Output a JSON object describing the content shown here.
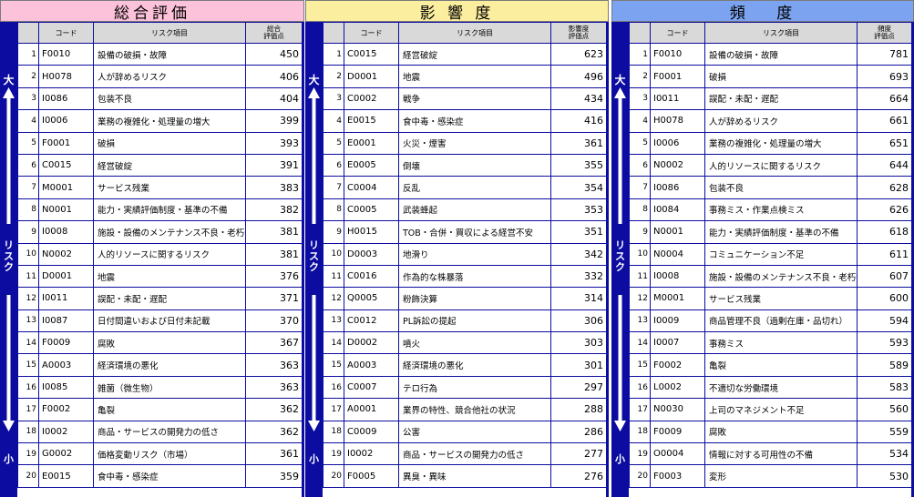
{
  "headers": {
    "code": "コード",
    "item": "リスク項目"
  },
  "side": {
    "big": "大",
    "small": "小",
    "mid": "リ\nス\nク"
  },
  "panels": [
    {
      "title": "総合評価",
      "title_bg": "#fcc2d9",
      "score_header": "総合\n評価点",
      "rows": [
        [
          "1",
          "F0010",
          "設備の破損・故障",
          "450"
        ],
        [
          "2",
          "H0078",
          "人が辞めるリスク",
          "406"
        ],
        [
          "3",
          "I0086",
          "包装不良",
          "404"
        ],
        [
          "4",
          "I0006",
          "業務の複雑化・処理量の増大",
          "399"
        ],
        [
          "5",
          "F0001",
          "破損",
          "393"
        ],
        [
          "6",
          "C0015",
          "経営破綻",
          "391"
        ],
        [
          "7",
          "M0001",
          "サービス残業",
          "383"
        ],
        [
          "8",
          "N0001",
          "能力・実績評価制度・基準の不備",
          "382"
        ],
        [
          "9",
          "I0008",
          "施設・設備のメンテナンス不良・老朽化",
          "381"
        ],
        [
          "10",
          "N0002",
          "人的リソースに関するリスク",
          "381"
        ],
        [
          "11",
          "D0001",
          "地震",
          "376"
        ],
        [
          "12",
          "I0011",
          "誤配・未配・遅配",
          "371"
        ],
        [
          "13",
          "I0087",
          "日付間違いおよび日付未記載",
          "370"
        ],
        [
          "14",
          "F0009",
          "腐敗",
          "367"
        ],
        [
          "15",
          "A0003",
          "経済環境の悪化",
          "363"
        ],
        [
          "16",
          "I0085",
          "雑菌（微生物）",
          "363"
        ],
        [
          "17",
          "F0002",
          "亀裂",
          "362"
        ],
        [
          "18",
          "I0002",
          "商品・サービスの開発力の低さ",
          "362"
        ],
        [
          "19",
          "G0002",
          "価格変動リスク（市場）",
          "361"
        ],
        [
          "20",
          "E0015",
          "食中毒・感染症",
          "359"
        ]
      ]
    },
    {
      "title": "影 響 度",
      "title_bg": "#fbee9e",
      "score_header": "影響度\n評価点",
      "rows": [
        [
          "1",
          "C0015",
          "経営破綻",
          "623"
        ],
        [
          "2",
          "D0001",
          "地震",
          "496"
        ],
        [
          "3",
          "C0002",
          "戦争",
          "434"
        ],
        [
          "4",
          "E0015",
          "食中毒・感染症",
          "416"
        ],
        [
          "5",
          "E0001",
          "火災・煙害",
          "361"
        ],
        [
          "6",
          "E0005",
          "倒壊",
          "355"
        ],
        [
          "7",
          "C0004",
          "反乱",
          "354"
        ],
        [
          "8",
          "C0005",
          "武装蜂起",
          "353"
        ],
        [
          "9",
          "H0015",
          "TOB・合併・買収による経営不安",
          "351"
        ],
        [
          "10",
          "D0003",
          "地滑り",
          "342"
        ],
        [
          "11",
          "C0016",
          "作為的な株暴落",
          "332"
        ],
        [
          "12",
          "Q0005",
          "粉飾決算",
          "314"
        ],
        [
          "13",
          "C0012",
          "PL訴訟の提起",
          "306"
        ],
        [
          "14",
          "D0002",
          "噴火",
          "303"
        ],
        [
          "15",
          "A0003",
          "経済環境の悪化",
          "301"
        ],
        [
          "16",
          "C0007",
          "テロ行為",
          "297"
        ],
        [
          "17",
          "A0001",
          "業界の特性、競合他社の状況",
          "288"
        ],
        [
          "18",
          "C0009",
          "公害",
          "286"
        ],
        [
          "19",
          "I0002",
          "商品・サービスの開発力の低さ",
          "277"
        ],
        [
          "20",
          "F0005",
          "異臭・異味",
          "276"
        ]
      ]
    },
    {
      "title": "頻 　度",
      "title_bg": "#7ca3ef",
      "score_header": "頻度\n評価点",
      "rows": [
        [
          "1",
          "F0010",
          "設備の破損・故障",
          "781"
        ],
        [
          "2",
          "F0001",
          "破損",
          "693"
        ],
        [
          "3",
          "I0011",
          "誤配・未配・遅配",
          "664"
        ],
        [
          "4",
          "H0078",
          "人が辞めるリスク",
          "661"
        ],
        [
          "5",
          "I0006",
          "業務の複雑化・処理量の増大",
          "651"
        ],
        [
          "6",
          "N0002",
          "人的リソースに関するリスク",
          "644"
        ],
        [
          "7",
          "I0086",
          "包装不良",
          "628"
        ],
        [
          "8",
          "I0084",
          "事務ミス・作業点検ミス",
          "626"
        ],
        [
          "9",
          "N0001",
          "能力・実績評価制度・基準の不備",
          "618"
        ],
        [
          "10",
          "N0004",
          "コミュニケーション不足",
          "611"
        ],
        [
          "11",
          "I0008",
          "施設・設備のメンテナンス不良・老朽化",
          "607"
        ],
        [
          "12",
          "M0001",
          "サービス残業",
          "600"
        ],
        [
          "13",
          "I0009",
          "商品管理不良（過剰在庫・品切れ）",
          "594"
        ],
        [
          "14",
          "I0007",
          "事務ミス",
          "593"
        ],
        [
          "15",
          "F0002",
          "亀裂",
          "589"
        ],
        [
          "16",
          "L0002",
          "不適切な労働環境",
          "583"
        ],
        [
          "17",
          "N0030",
          "上司のマネジメント不足",
          "560"
        ],
        [
          "18",
          "F0009",
          "腐敗",
          "559"
        ],
        [
          "19",
          "O0004",
          "情報に対する可用性の不備",
          "534"
        ],
        [
          "20",
          "F0003",
          "変形",
          "530"
        ]
      ]
    }
  ]
}
